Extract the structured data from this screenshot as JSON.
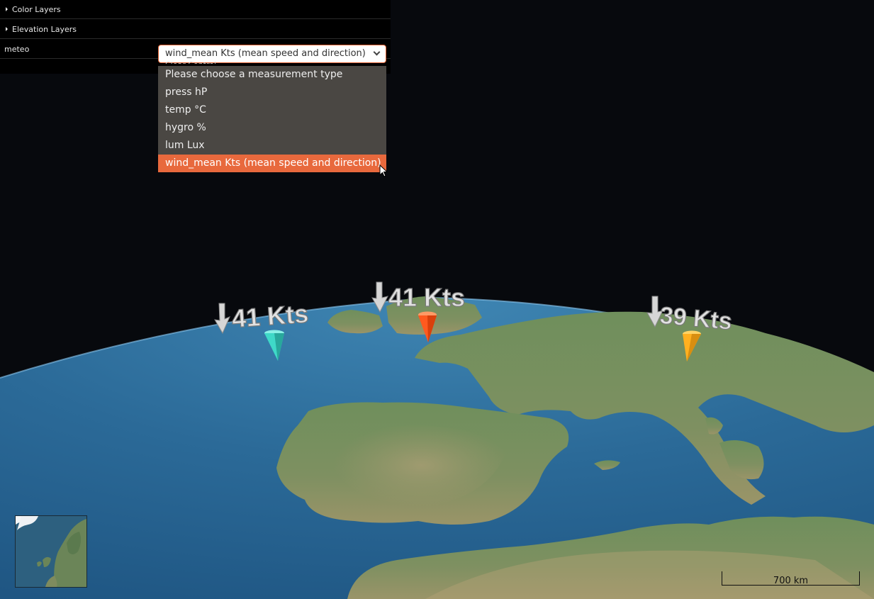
{
  "panel": {
    "color_layers": "Color Layers",
    "elevation_layers": "Elevation Layers",
    "meteo_label": "meteo",
    "select_value": "wind_mean Kts (mean speed and direction)",
    "clipped_text": "Clear Control"
  },
  "dropdown": {
    "options": [
      "Please choose a measurement type",
      "press hP",
      "temp °C",
      "hygro %",
      "lum Lux",
      "wind_mean Kts (mean speed and direction)"
    ],
    "selected_index": 5
  },
  "markers": [
    {
      "label": "41 Kts",
      "color": "#3fd9c8"
    },
    {
      "label": "41 Kts",
      "color": "#ff5a1f"
    },
    {
      "label": "39 Kts",
      "color": "#ffb020"
    }
  ],
  "scale": {
    "label": "700 km"
  },
  "icons": {
    "expand": "triangle-right-icon",
    "select": "chevron-down-icon",
    "wind": "arrow-down-icon",
    "cursor": "mouse-pointer-icon"
  }
}
